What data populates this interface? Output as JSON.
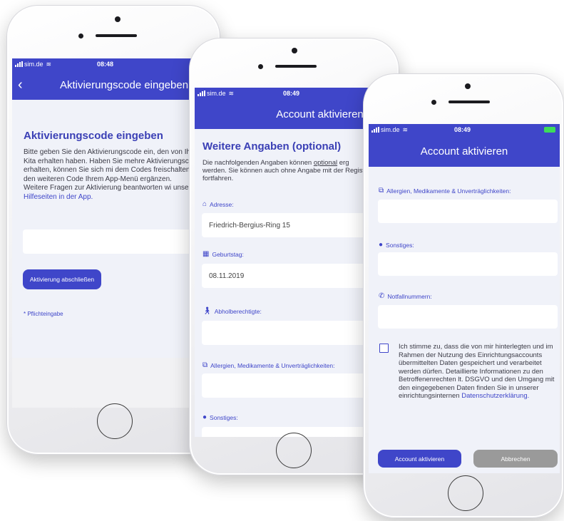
{
  "colors": {
    "accent": "#3f46c9",
    "heading": "#3a3fb5",
    "grey_button": "#9a9a9a",
    "battery": "#3ddc5a"
  },
  "phone1": {
    "status": {
      "carrier": "sim.de",
      "time": "08:48"
    },
    "appbar_title": "Aktivierungscode eingeben",
    "back_icon": "chevron-left-icon",
    "heading": "Aktivierungscode eingeben",
    "paragraph": "Bitte geben Sie den Aktivierungscode ein, den von Ihrer Kita erhalten haben. Haben Sie mehre Aktivierungscodes erhalten, können Sie sich mi dem Codes freischalten und den weiteren Code Ihrem App-Menü ergänzen.",
    "paragraph2_prefix": "Weitere Fragen zur Aktivierung beantworten wi unseren",
    "help_link": "Hilfeseiten in der App.",
    "submit_label": "Aktivierung abschließen",
    "required_note": "* Pflichteingabe"
  },
  "phone2": {
    "status": {
      "carrier": "sim.de",
      "time": "08:49"
    },
    "appbar_title": "Account aktivieren",
    "heading": "Weitere Angaben (optional)",
    "intro_prefix": "Die nachfolgenden Angaben können",
    "intro_optional": "optional",
    "intro_cut": "erg",
    "intro_rest": "werden. Sie können auch ohne Angabe mit der Registrierung fortfahren.",
    "address_label": "Adresse:",
    "address_value": "Friedrich-Bergius-Ring 15",
    "birthday_label": "Geburtstag:",
    "birthday_value": "08.11.2019",
    "pickup_label": "Abholberechtigte:",
    "allergies_label": "Allergien, Medikamente & Unverträglichkeiten:",
    "other_label": "Sonstiges:"
  },
  "phone3": {
    "status": {
      "carrier": "sim.de",
      "time": "08:49"
    },
    "appbar_title": "Account aktivieren",
    "allergies_label": "Allergien, Medikamente & Unverträglichkeiten:",
    "other_label": "Sonstiges:",
    "emergency_label": "Notfallnummern:",
    "consent_text": "Ich stimme zu, dass die von mir hinterlegten und im Rahmen der Nutzung des Einrichtungsaccounts übermittelten Daten gespeichert und verarbeitet werden dürfen. Detaillierte Informationen zu den Betroffenenrechten lt. DSGVO und den Umgang mit den eingegebenen Daten finden Sie in unserer einrichtungsinternen",
    "privacy_link": "Datenschutzerklärung.",
    "activate_label": "Account aktivieren",
    "cancel_label": "Abbrechen"
  }
}
